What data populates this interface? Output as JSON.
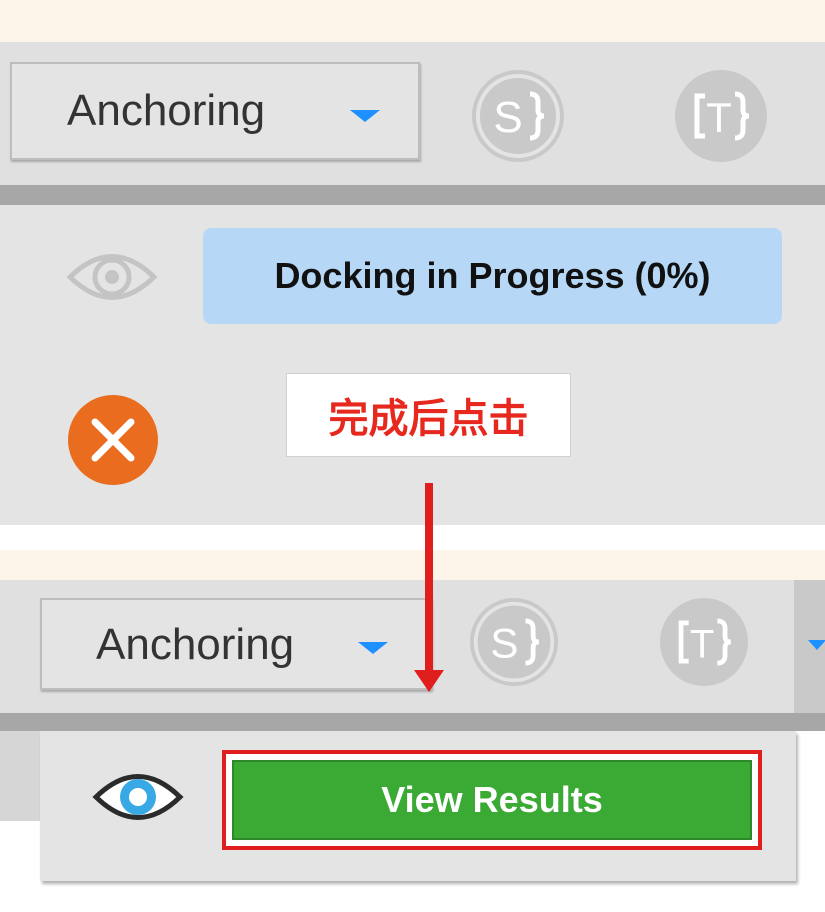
{
  "top_panel": {
    "mode_dropdown": {
      "label": "Anchoring",
      "caret_icon": "caret-down-icon"
    },
    "icons": {
      "s_button": "s-bracket-icon",
      "t_button": "t-bracket-icon",
      "visibility": "eye-outline-icon",
      "cancel": "close-icon"
    },
    "progress_text": "Docking in Progress (0%)"
  },
  "callout": {
    "text": "完成后点击"
  },
  "bottom_panel": {
    "mode_dropdown": {
      "label": "Anchoring",
      "caret_icon": "caret-down-icon"
    },
    "icons": {
      "s_button": "s-bracket-icon",
      "t_button": "t-bracket-icon",
      "visibility": "eye-active-icon"
    },
    "view_results_label": "View Results"
  },
  "colors": {
    "accent_blue": "#1e90ff",
    "progress_bg": "#b6d8f6",
    "cancel_orange": "#ea6c1f",
    "results_green": "#3aaa35",
    "highlight_red": "#e01e1e"
  }
}
